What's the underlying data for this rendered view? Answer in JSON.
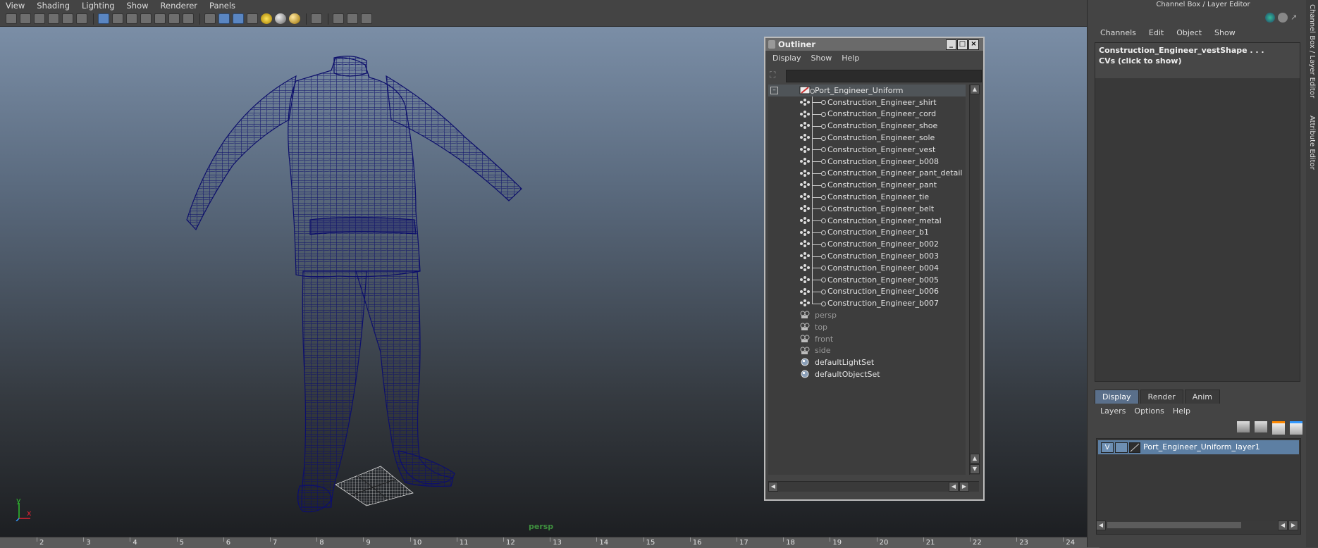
{
  "viewport": {
    "menu": [
      "View",
      "Shading",
      "Lighting",
      "Show",
      "Renderer",
      "Panels"
    ],
    "camera_label": "persp",
    "axis": {
      "x": "x",
      "y": "y"
    },
    "wire_color": "#0d0f6b"
  },
  "toolbar_icons": [
    "select-camera-icon",
    "lock-camera-icon",
    "bookmark-icon",
    "image-plane-icon",
    "2d-pan-icon",
    "grease-pencil-icon",
    "grid-icon",
    "film-gate-icon",
    "resolution-gate-icon",
    "gate-mask-icon",
    "field-chart-icon",
    "safe-action-icon",
    "safe-title-icon",
    "wireframe-icon",
    "smooth-shade-icon",
    "default-material-icon",
    "textured-icon",
    "use-all-lights-icon",
    "shadows-icon",
    "ambient-occlusion-icon",
    "isolate-select-icon",
    "xray-icon",
    "xray-joints-icon",
    "xray-components-icon"
  ],
  "outliner": {
    "title": "Outliner",
    "menu": [
      "Display",
      "Show",
      "Help"
    ],
    "root": "Port_Engineer_Uniform",
    "children": [
      "Construction_Engineer_shirt",
      "Construction_Engineer_cord",
      "Construction_Engineer_shoe",
      "Construction_Engineer_sole",
      "Construction_Engineer_vest",
      "Construction_Engineer_b008",
      "Construction_Engineer_pant_detail",
      "Construction_Engineer_pant",
      "Construction_Engineer_tie",
      "Construction_Engineer_belt",
      "Construction_Engineer_metal",
      "Construction_Engineer_b1",
      "Construction_Engineer_b002",
      "Construction_Engineer_b003",
      "Construction_Engineer_b004",
      "Construction_Engineer_b005",
      "Construction_Engineer_b006",
      "Construction_Engineer_b007"
    ],
    "cameras": [
      "persp",
      "top",
      "front",
      "side"
    ],
    "sets": [
      "defaultLightSet",
      "defaultObjectSet"
    ]
  },
  "channel_box": {
    "header": "Channel Box / Layer Editor",
    "menu": [
      "Channels",
      "Edit",
      "Object",
      "Show"
    ],
    "object_name": "Construction_Engineer_vestShape . . .",
    "cvs_label": "CVs (click to show)",
    "side_tabs": [
      "Channel Box / Layer Editor",
      "Attribute Editor"
    ]
  },
  "layer_editor": {
    "tabs": [
      "Display",
      "Render",
      "Anim"
    ],
    "active_tab": "Display",
    "menu": [
      "Layers",
      "Options",
      "Help"
    ],
    "layer": {
      "visible": "V",
      "name": "Port_Engineer_Uniform_layer1"
    }
  },
  "timeline": {
    "ticks": [
      "2",
      "3",
      "4",
      "5",
      "6",
      "7",
      "8",
      "9",
      "10",
      "11",
      "12",
      "13",
      "14",
      "15",
      "16",
      "17",
      "18",
      "19",
      "20",
      "21",
      "22",
      "23",
      "24"
    ]
  }
}
